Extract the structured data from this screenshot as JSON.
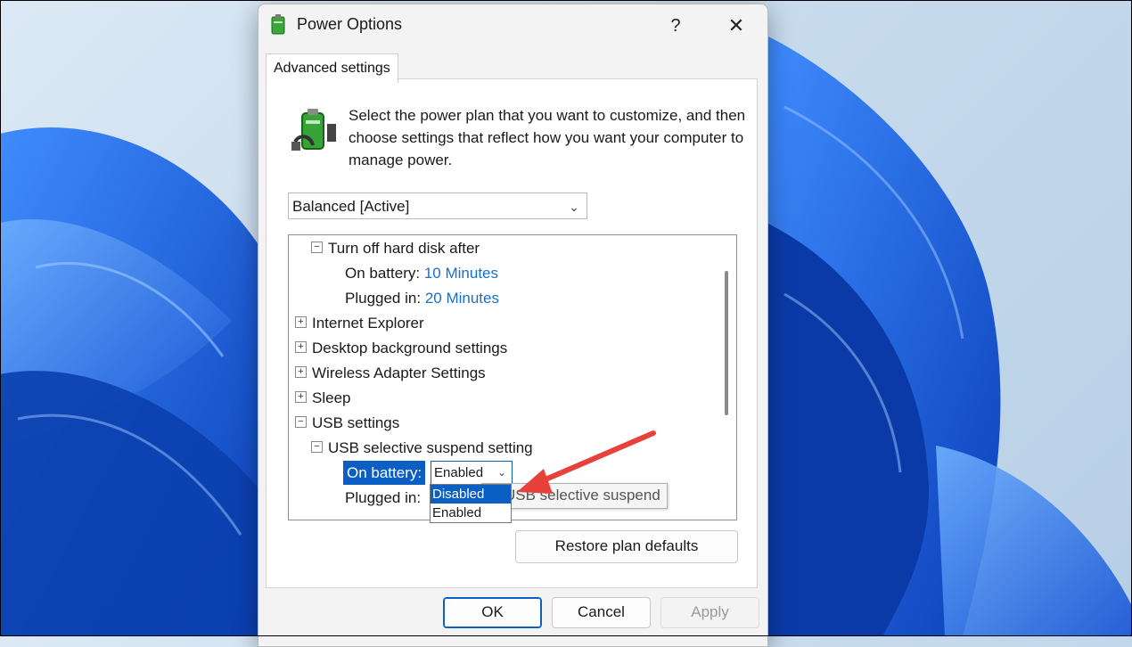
{
  "window": {
    "title": "Power Options",
    "help_glyph": "?",
    "close_glyph": "✕",
    "icon": "power-options-icon"
  },
  "tab": {
    "label": "Advanced settings"
  },
  "intro": {
    "text": "Select the power plan that you want to customize, and then choose settings that reflect how you want your computer to manage power.",
    "icon": "battery-plug-icon"
  },
  "plan_select": {
    "value": "Balanced [Active]"
  },
  "tree": {
    "hard_disk": {
      "label": "Turn off hard disk after",
      "on_battery_label": "On battery:",
      "on_battery_value": "10 Minutes",
      "plugged_in_label": "Plugged in:",
      "plugged_in_value": "20 Minutes"
    },
    "internet_explorer": "Internet Explorer",
    "desktop_background": "Desktop background settings",
    "wireless_adapter": "Wireless Adapter Settings",
    "sleep": "Sleep",
    "usb_settings": "USB settings",
    "usb_suspend": {
      "label": "USB selective suspend setting",
      "on_battery_label": "On battery:",
      "on_battery_value": "Enabled",
      "plugged_in_label": "Plugged in:"
    },
    "expand_glyph": "+",
    "collapse_glyph": "−"
  },
  "dropdown": {
    "options": [
      "Disabled",
      "Enabled"
    ],
    "highlighted": "Disabled"
  },
  "tooltip": {
    "text": "le USB selective suspend"
  },
  "buttons": {
    "restore": "Restore plan defaults",
    "ok": "OK",
    "cancel": "Cancel",
    "apply": "Apply"
  },
  "colors": {
    "accent": "#0b5fc4",
    "link": "#1a6fc9",
    "arrow": "#e8413b"
  }
}
